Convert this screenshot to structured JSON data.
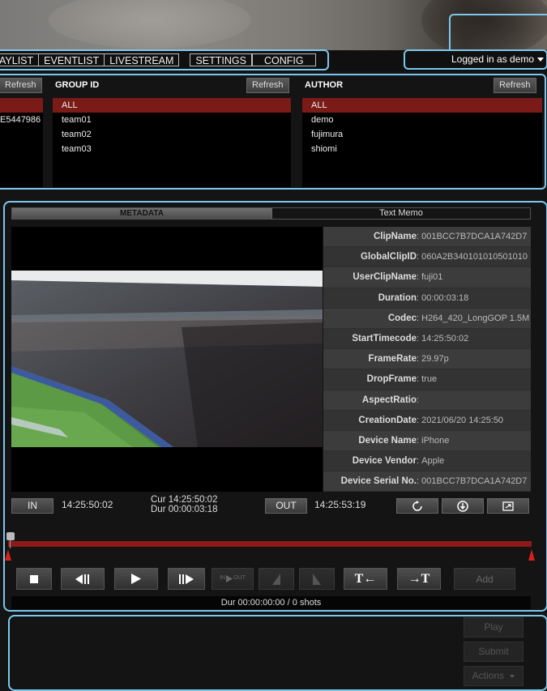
{
  "nav": {
    "tabs": [
      "AYLIST",
      "EVENTLIST",
      "LIVESTREAM",
      "SETTINGS",
      "CONFIG"
    ],
    "login_text": "Logged in as demo"
  },
  "filters": {
    "refresh_label": "Refresh",
    "left_partial": "E5447986",
    "group": {
      "title": "GROUP ID",
      "items": [
        "ALL",
        "team01",
        "team02",
        "team03"
      ]
    },
    "author": {
      "title": "AUTHOR",
      "items": [
        "ALL",
        "demo",
        "fujimura",
        "shiomi"
      ]
    }
  },
  "player": {
    "tabs": {
      "metadata": "METADATA",
      "text_memo": "Text Memo"
    },
    "metadata": [
      {
        "key": "ClipName",
        "value": "001BCC7B7DCA1A742D7"
      },
      {
        "key": "GlobalClipID",
        "value": "060A2B340101010501010"
      },
      {
        "key": "UserClipName",
        "value": "fuji01"
      },
      {
        "key": "Duration",
        "value": "00:00:03:18"
      },
      {
        "key": "Codec",
        "value": "H264_420_LongGOP 1.5M"
      },
      {
        "key": "StartTimecode",
        "value": "14:25:50:02"
      },
      {
        "key": "FrameRate",
        "value": "29.97p"
      },
      {
        "key": "DropFrame",
        "value": "true"
      },
      {
        "key": "AspectRatio",
        "value": ""
      },
      {
        "key": "CreationDate",
        "value": "2021/06/20 14:25:50"
      },
      {
        "key": "Device Name",
        "value": "iPhone"
      },
      {
        "key": "Device Vendor",
        "value": "Apple"
      },
      {
        "key": "Device Serial No.",
        "value": "001BCC7B7DCA1A742D7"
      }
    ],
    "in_label": "IN",
    "in_tc": "14:25:50:02",
    "cur_line": "Cur  14:25:50:02",
    "dur_line": "Dur  00:00:03:18",
    "out_label": "OUT",
    "out_tc": "14:25:53:19",
    "inout_small_in": "IN",
    "inout_small_out": "OUT",
    "add_label": "Add",
    "dur_shots": "Dur 00:00:00:00 / 0 shots"
  },
  "bottom": {
    "play_label": "Play",
    "submit_label": "Submit",
    "actions_label": "Actions"
  }
}
